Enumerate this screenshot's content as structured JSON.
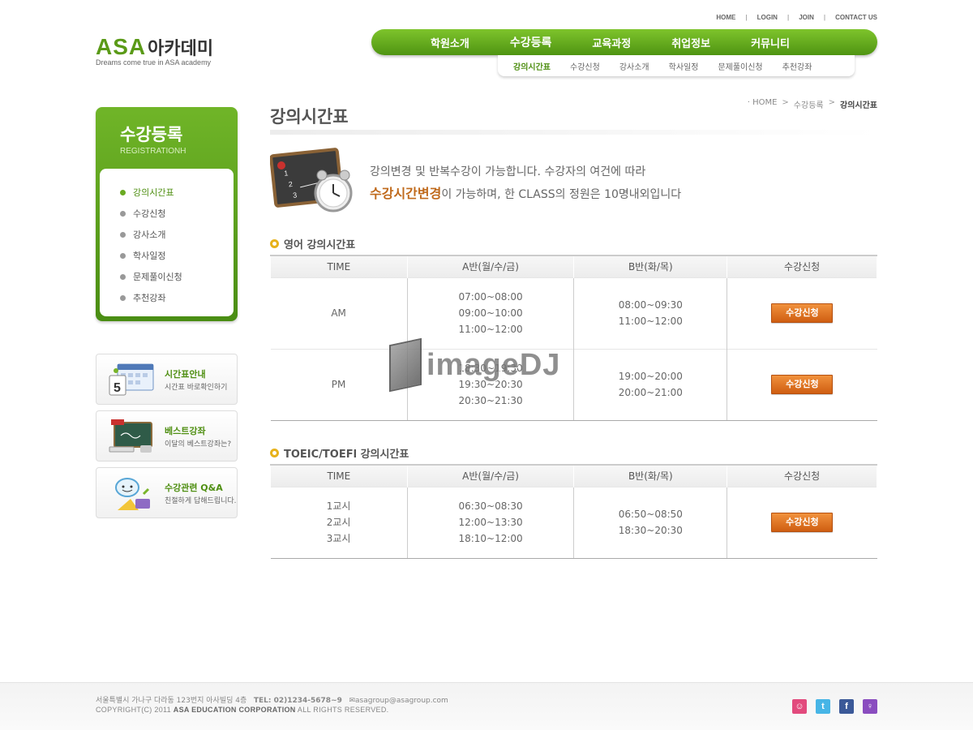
{
  "util": [
    "HOME",
    "LOGIN",
    "JOIN",
    "CONTACT US"
  ],
  "logo": {
    "en": "ASA",
    "kr": "아카데미",
    "tagline": "Dreams come true in ASA academy"
  },
  "gnb": [
    "학원소개",
    "수강등록",
    "교육과정",
    "취업정보",
    "커뮤니티"
  ],
  "lnb": [
    "강의시간표",
    "수강신청",
    "강사소개",
    "학사일정",
    "문제풀이신청",
    "추천강좌"
  ],
  "sidebar": {
    "title": "수강등록",
    "subtitle": "REGISTRATIONH",
    "items": [
      "강의시간표",
      "수강신청",
      "강사소개",
      "학사일정",
      "문제풀이신청",
      "추천강좌"
    ]
  },
  "banners": [
    {
      "title": "시간표안내",
      "sub": "시간표 바로확인하기"
    },
    {
      "title": "베스트강좌",
      "sub": "이달의 베스트강좌는?"
    },
    {
      "title": "수강관련 Q&A",
      "sub": "친절하게 답해드립니다."
    }
  ],
  "page": {
    "title": "강의시간표"
  },
  "breadcrumb": {
    "home": "HOME",
    "mid": "수강등록",
    "current": "강의시간표"
  },
  "intro": {
    "line1": "강의변경 및 반복수강이 가능합니다. 수강자의 여건에 따라",
    "highlight": "수강시간변경",
    "line2_rest": "이 가능하며, 한 CLASS의 정원은 10명내외입니다"
  },
  "english": {
    "title": "영어 강의시간표",
    "headers": [
      "TIME",
      "A반(월/수/금)",
      "B반(화/목)",
      "수강신청"
    ],
    "rows": [
      {
        "time": "AM",
        "a": [
          "07:00~08:00",
          "09:00~10:00",
          "11:00~12:00"
        ],
        "b": [
          "08:00~09:30",
          "11:00~12:00"
        ],
        "btn": "수강신청"
      },
      {
        "time": "PM",
        "a": [
          "18:30~19:30",
          "19:30~20:30",
          "20:30~21:30"
        ],
        "b": [
          "19:00~20:00",
          "20:00~21:00"
        ],
        "btn": "수강신청"
      }
    ]
  },
  "toeic": {
    "title": "TOEIC/TOEFl 강의시간표",
    "headers": [
      "TIME",
      "A반(월/수/금)",
      "B반(화/목)",
      "수강신청"
    ],
    "rows": [
      {
        "time": [
          "1교시",
          "2교시",
          "3교시"
        ],
        "a": [
          "06:30~08:30",
          "12:00~13:30",
          "18:10~12:00"
        ],
        "b": [
          "06:50~08:50",
          "18:30~20:30"
        ],
        "btn": "수강신청"
      }
    ]
  },
  "watermark": "imageDJ",
  "footer": {
    "address": "서울특별시 가나구 다라동 123번지 아사빌딩 4층",
    "tel": "TEL: 02)1234-5678~9",
    "email": "asagroup@asagroup.com",
    "copyright_pre": "COPYRIGHT(C) 2011 ",
    "copyright_corp": "ASA EDUCATION CORPORATION",
    "copyright_post": " ALL RIGHTS RESERVED."
  },
  "colors": {
    "green": "#5a9a17",
    "orange": "#d0651a",
    "yellow": "#e7b21b"
  }
}
